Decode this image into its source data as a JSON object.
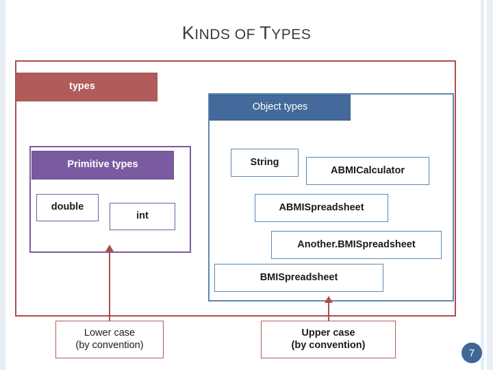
{
  "slide": {
    "title": {
      "part1_cap": "K",
      "part1_rest": "INDS OF ",
      "part2_cap": "T",
      "part2_rest": "YPES"
    },
    "page_number": "7"
  },
  "boxes": {
    "types": "types",
    "object_types": "Object types",
    "primitive_types": "Primitive types",
    "double": "double",
    "int": "int",
    "string": "String",
    "abmicalculator": "ABMICalculator",
    "abmispreadsheet": "ABMISpreadsheet",
    "anotherbmispreadsheet": "Another.BMISpreadsheet",
    "bmispreadsheet": "BMISpreadsheet"
  },
  "captions": {
    "lower_line1": "Lower case",
    "lower_line2": "(by convention)",
    "upper_line1": "Upper case",
    "upper_line2": "(by convention)"
  },
  "colors": {
    "red_border": "#b04a4a",
    "red_fill": "#b15b5b",
    "blue_fill": "#436a9a",
    "blue_border": "#5b87b0",
    "purple_fill": "#7a5aa0",
    "badge": "#3f6795",
    "edge_bar": "#e8eef5"
  }
}
